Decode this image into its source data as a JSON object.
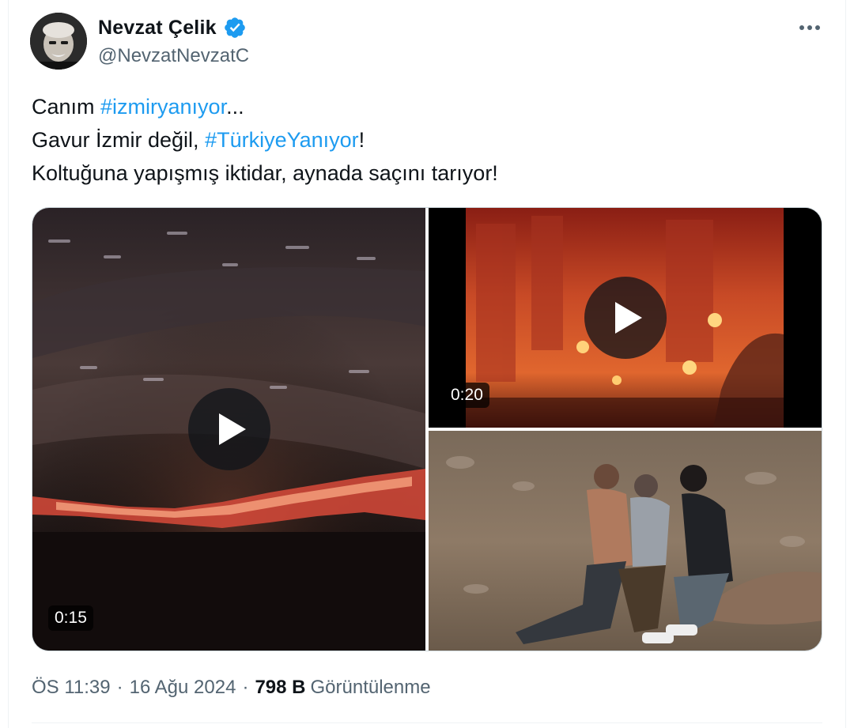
{
  "author": {
    "display_name": "Nevzat Çelik",
    "handle": "@NevzatNevzatC",
    "verified": true
  },
  "tweet": {
    "line1_prefix": "Canım ",
    "line1_hashtag": "#izmiryanıyor",
    "line1_suffix": "...",
    "line2_prefix": "Gavur İzmir değil, ",
    "line2_hashtag": "#TürkiyeYanıyor",
    "line2_suffix": "!",
    "line3": "Koltuğuna yapışmış iktidar, aynada saçını tarıyor!"
  },
  "media": [
    {
      "kind": "video",
      "duration": "0:15"
    },
    {
      "kind": "video",
      "duration": "0:20"
    },
    {
      "kind": "photo"
    }
  ],
  "meta": {
    "time": "ÖS 11:39",
    "date": "16 Ağu 2024",
    "views_count": "798 B",
    "views_label": "Görüntülenme",
    "separator": "·"
  },
  "colors": {
    "link": "#1d9bf0",
    "text": "#0f1419",
    "secondary": "#536471"
  },
  "icons": [
    "verified-badge-icon",
    "more-options-icon",
    "play-icon"
  ]
}
